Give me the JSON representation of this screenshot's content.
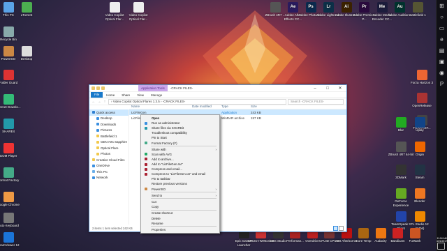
{
  "colors": {
    "accent": "#1979ca",
    "selection": "#cce8ff",
    "app_tools_tab": "#c9a6ea",
    "taskbar": "#101015"
  },
  "desktop": {
    "left_icons": [
      {
        "label": "This PC",
        "icon": "computer-icon",
        "color": "#5aa3e6"
      },
      {
        "label": "uTorrent",
        "icon": "utorrent-icon",
        "color": "#4caf50"
      },
      {
        "label": "Recycle Bin",
        "icon": "recycle-bin-icon",
        "color": "#8aa"
      },
      {
        "label": "PowerISO",
        "icon": "poweriso-icon",
        "color": "#c84"
      },
      {
        "label": "Desktop",
        "icon": "shortcut-icon",
        "color": "#ddd"
      },
      {
        "label": "Folder Guard",
        "icon": "folder-guard-icon",
        "color": "#d33"
      },
      {
        "label": "Internet Downlo...",
        "icon": "idm-icon",
        "color": "#3b7"
      },
      {
        "label": "SHAREit",
        "icon": "shareit-icon",
        "color": "#29a"
      },
      {
        "label": "GOM Player",
        "icon": "gom-player-icon",
        "color": "#e33"
      },
      {
        "label": "Format Factory",
        "icon": "format-factory-icon",
        "color": "#4a8"
      },
      {
        "label": "Google Chrome",
        "icon": "chrome-icon",
        "color": "#e94"
      },
      {
        "label": "Auto Keyboard",
        "icon": "keyboard-icon",
        "color": "#777"
      },
      {
        "label": "TeamViewer 12",
        "icon": "teamviewer-icon",
        "color": "#1b74d8"
      }
    ],
    "top_files": [
      {
        "label": "Video Copilot Optical Flar...",
        "icon": "document-icon"
      },
      {
        "label": "Video Copilot Optical Flar...",
        "icon": "document-icon"
      }
    ],
    "top_apps": [
      {
        "label": "ZBrush 4R7 ...",
        "icon": "zbrush-icon",
        "color": "#555"
      },
      {
        "label": "Adobe After Effects CC...",
        "icon": "after-effects-icon",
        "color": "#2a1b5e",
        "abbr": "Ae"
      },
      {
        "label": "Adobe Photosh...",
        "icon": "photoshop-icon",
        "color": "#0b2a4e",
        "abbr": "Ps"
      },
      {
        "label": "Adobe Lightroom",
        "icon": "lightroom-icon",
        "color": "#0c3048",
        "abbr": "Lr"
      },
      {
        "label": "Adobe Illustrator",
        "icon": "illustrator-icon",
        "color": "#3b2200",
        "abbr": "Ai"
      },
      {
        "label": "Adobe Premiere P...",
        "icon": "premiere-icon",
        "color": "#2a0b3e",
        "abbr": "Pr"
      },
      {
        "label": "Adobe Media Encoder CC...",
        "icon": "media-encoder-icon",
        "color": "#1c1c3c",
        "abbr": "Me"
      },
      {
        "label": "Adobe Audition...",
        "icon": "audition-icon",
        "color": "#00332e",
        "abbr": "Au"
      },
      {
        "label": "Battlefield 1",
        "icon": "battlefield-icon",
        "color": "#553"
      }
    ],
    "right_icons": [
      {
        "label": "Forza Horizon 3",
        "icon": "forza-icon",
        "color": "#e63"
      },
      {
        "label": "OpenRelease",
        "icon": "app-icon",
        "color": "#a33"
      },
      {
        "label": "TRAPPIST...",
        "icon": "app-icon",
        "color": "#444"
      },
      {
        "label": "Blur",
        "icon": "blur-icon",
        "color": "#2a2"
      },
      {
        "label": "Uplay",
        "icon": "uplay-icon",
        "color": "#148"
      },
      {
        "label": "ZBrush 4R7 64-bit",
        "icon": "zbrush-icon",
        "color": "#555"
      },
      {
        "label": "Origin",
        "icon": "origin-icon",
        "color": "#e60"
      },
      {
        "label": "3DMark",
        "icon": "3dmark-icon",
        "color": "#333"
      },
      {
        "label": "Steam",
        "icon": "steam-icon",
        "color": "#234"
      },
      {
        "label": "GeForce Experience",
        "icon": "geforce-icon",
        "color": "#6a2"
      },
      {
        "label": "Blender",
        "icon": "blender-icon",
        "color": "#e72"
      },
      {
        "label": "TeamSpeak 3 Client",
        "icon": "teamspeak-icon",
        "color": "#24a"
      },
      {
        "label": "FL Studio 12 (64bit)",
        "icon": "fl-studio-icon",
        "color": "#e80"
      }
    ],
    "bottom_apps": [
      {
        "label": "Epic Games Launcher",
        "icon": "epic-icon",
        "color": "#222"
      },
      {
        "label": "CPUID HWMonitor",
        "icon": "hwmonitor-icon",
        "color": "#c33"
      },
      {
        "label": "OBS Studio",
        "icon": "obs-icon",
        "color": "#333"
      },
      {
        "label": "Performan...",
        "icon": "app-icon",
        "color": "#a22"
      },
      {
        "label": "Overdrive",
        "icon": "overdrive-icon",
        "color": "#b22"
      },
      {
        "label": "CPUID CPU-Z",
        "icon": "cpuz-icon",
        "color": "#733"
      },
      {
        "label": "MSI Afterburner",
        "icon": "afterburner-icon",
        "color": "#b11"
      },
      {
        "label": "Core Temp",
        "icon": "coretemp-icon",
        "color": "#a61"
      },
      {
        "label": "Audacity",
        "icon": "audacity-icon",
        "color": "#e71"
      },
      {
        "label": "Bandicam",
        "icon": "bandicam-icon",
        "color": "#c22"
      },
      {
        "label": "FurMark",
        "icon": "furmark-icon",
        "color": "#c52"
      }
    ]
  },
  "taskbar": {
    "items": [
      "windows-icon",
      "cortana-icon",
      "task-view-icon",
      "edge-icon",
      "explorer-icon",
      "store-icon",
      "chrome-icon",
      "photoshop-icon"
    ],
    "time": "11:04 AM",
    "date": "4/21/2017"
  },
  "explorer": {
    "app_tools_label": "Application Tools",
    "title": "-CRACK FILES-",
    "ribbon_tabs": [
      "File",
      "Home",
      "Share",
      "View",
      "Manage"
    ],
    "address": "›  Video Copilot Optical Flares 1.3.5  ›  -CRACK FILES-",
    "search_placeholder": "Search -CRACK FILES-",
    "nav": [
      {
        "label": "Quick access",
        "icon": "star",
        "indent": false,
        "active": true
      },
      {
        "label": "Desktop",
        "icon": "blue",
        "indent": true
      },
      {
        "label": "Downloads",
        "icon": "blue",
        "indent": true
      },
      {
        "label": "Pictures",
        "icon": "blue",
        "indent": true
      },
      {
        "label": "Battlefield 1",
        "icon": "",
        "indent": true
      },
      {
        "label": "GEN Arts Sapphire",
        "icon": "",
        "indent": true
      },
      {
        "label": "Optical Flare",
        "icon": "",
        "indent": true
      },
      {
        "label": "Photos",
        "icon": "",
        "indent": true
      },
      {
        "label": "Creative Cloud Files",
        "icon": "",
        "indent": false
      },
      {
        "label": "OneDrive",
        "icon": "blue",
        "indent": false
      },
      {
        "label": "This PC",
        "icon": "pc",
        "indent": false
      },
      {
        "label": "Network",
        "icon": "blue",
        "indent": false
      }
    ],
    "columns": [
      "Name",
      "Date modified",
      "Type",
      "Size"
    ],
    "files": [
      {
        "name": "LicFileGen",
        "date": "",
        "type": "Application",
        "size": "243 KB",
        "selected": true
      },
      {
        "name": "LicFileGen",
        "date": "",
        "type": "WinRAR archive",
        "size": "157 KB",
        "selected": false
      }
    ],
    "status": "2 items    1 item selected  242 KB"
  },
  "context_menu": {
    "items": [
      {
        "label": "Open",
        "bold": true
      },
      {
        "label": "Run as administrator",
        "icon": "#3a8fe0"
      },
      {
        "label": "Share files via SHAREit",
        "icon": "#29a"
      },
      {
        "label": "Troubleshoot compatibility"
      },
      {
        "label": "Pin to Start"
      },
      {
        "label": "Format Factory (F)",
        "icon": "#4a8"
      },
      {
        "sep": true
      },
      {
        "label": "Share with",
        "sub": true
      },
      {
        "label": "Scan with AVG",
        "icon": "#2a6"
      },
      {
        "label": "Add to archive...",
        "icon": "#a23"
      },
      {
        "label": "Add to \"LicFileGen.rar\"",
        "icon": "#a23"
      },
      {
        "label": "Compress and email...",
        "icon": "#a23"
      },
      {
        "label": "Compress to \"LicFileGen.rar\" and email",
        "icon": "#a23"
      },
      {
        "label": "Pin to taskbar"
      },
      {
        "label": "Restore previous versions"
      },
      {
        "label": "PowerISO",
        "icon": "#c84",
        "sub": true
      },
      {
        "sep": true
      },
      {
        "label": "Send to",
        "sub": true
      },
      {
        "sep": true
      },
      {
        "label": "Cut"
      },
      {
        "label": "Copy"
      },
      {
        "sep": true
      },
      {
        "label": "Create shortcut"
      },
      {
        "label": "Delete"
      },
      {
        "label": "Rename"
      },
      {
        "sep": true
      },
      {
        "label": "Properties"
      }
    ]
  }
}
